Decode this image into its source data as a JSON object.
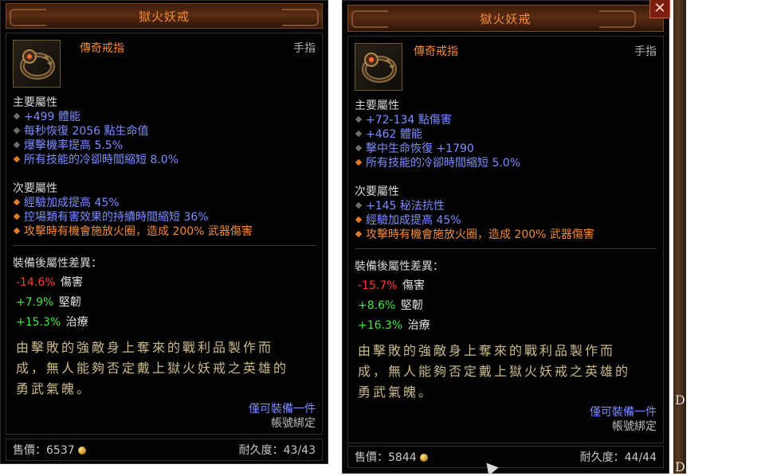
{
  "left": {
    "title": "獄火妖戒",
    "item_type": "傳奇戒指",
    "slot": "手指",
    "primary_header": "主要屬性",
    "primary": [
      {
        "text": "+499 體能",
        "bullet": "grey"
      },
      {
        "text": "每秒恢復 2056 點生命值",
        "bullet": "grey"
      },
      {
        "text": "爆擊機率提高 5.5%",
        "bullet": "grey"
      },
      {
        "text": "所有技能的冷卻時間縮短 8.0%",
        "bullet": "orange"
      }
    ],
    "secondary_header": "次要屬性",
    "secondary": [
      {
        "text": "經驗加成提高 45%",
        "bullet": "orange",
        "color": "blue"
      },
      {
        "text": "控場類有害效果的持續時間縮短 36%",
        "bullet": "orange",
        "color": "blue"
      },
      {
        "text": "攻擊時有機會施放火圈，造成 200% 武器傷害",
        "bullet": "orange",
        "color": "orange"
      }
    ],
    "compare_header": "裝備後屬性差異：",
    "compare": [
      {
        "value": "-14.6%",
        "label": "傷害",
        "sign": "neg"
      },
      {
        "value": "+7.9%",
        "label": "堅韌",
        "sign": "pos"
      },
      {
        "value": "+15.3%",
        "label": "治療",
        "sign": "pos"
      }
    ],
    "flavor_1": "由擊敗的強敵身上奪來的戰利品製作而",
    "flavor_2": "成，無人能夠否定戴上獄火妖戒之英雄的",
    "flavor_3": "勇武氣魄。",
    "equip_note": "僅可裝備一件",
    "bound_note": "帳號綁定",
    "sell_label": "售價：",
    "sell_value": "6537",
    "durability_label": "耐久度：",
    "durability_value": "43/43"
  },
  "right": {
    "title": "獄火妖戒",
    "item_type": "傳奇戒指",
    "slot": "手指",
    "primary_header": "主要屬性",
    "primary": [
      {
        "text": "+72-134 點傷害",
        "bullet": "grey"
      },
      {
        "text": "+462 體能",
        "bullet": "grey"
      },
      {
        "text": "擊中生命恢復 +1790",
        "bullet": "grey"
      },
      {
        "text": "所有技能的冷卻時間縮短 5.0%",
        "bullet": "orange"
      }
    ],
    "secondary_header": "次要屬性",
    "secondary": [
      {
        "text": "+145 秘法抗性",
        "bullet": "grey",
        "color": "blue"
      },
      {
        "text": "經驗加成提高 45%",
        "bullet": "orange",
        "color": "blue"
      },
      {
        "text": "攻擊時有機會施放火圈，造成 200% 武器傷害",
        "bullet": "orange",
        "color": "orange"
      }
    ],
    "compare_header": "裝備後屬性差異：",
    "compare": [
      {
        "value": "-15.7%",
        "label": "傷害",
        "sign": "neg"
      },
      {
        "value": "+8.6%",
        "label": "堅韌",
        "sign": "pos"
      },
      {
        "value": "+16.3%",
        "label": "治療",
        "sign": "pos"
      }
    ],
    "flavor_1": "由擊敗的強敵身上奪來的戰利品製作而",
    "flavor_2": "成，無人能夠否定戴上獄火妖戒之英雄的",
    "flavor_3": "勇武氣魄。",
    "equip_note": "僅可裝備一件",
    "bound_note": "帳號綁定",
    "sell_label": "售價：",
    "sell_value": "5844",
    "durability_label": "耐久度：",
    "durability_value": "44/44",
    "close_glyph": "✕"
  },
  "background": {
    "glyph_1": "D",
    "glyph_2": "D"
  },
  "colors": {
    "title": "#f08a3a",
    "magic_blue": "#7d8dff",
    "legendary_orange": "#f08a3a",
    "negative": "#ff3a3a",
    "positive": "#3ee63e"
  }
}
